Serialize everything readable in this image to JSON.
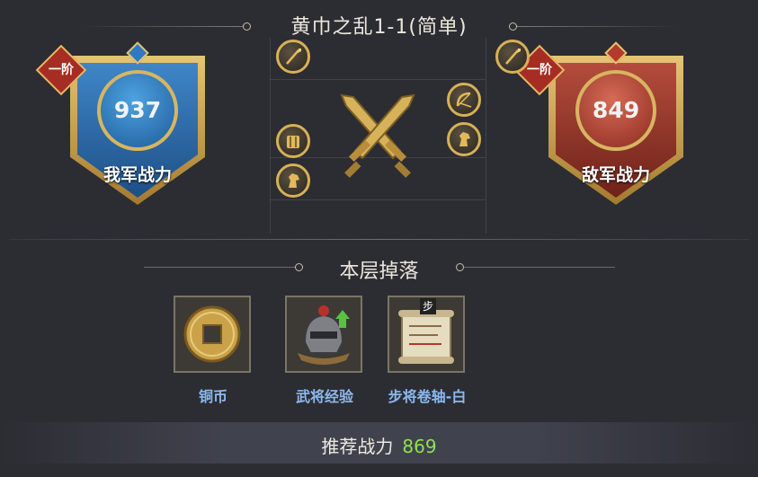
{
  "stage_title": "黄巾之乱1-1(简单)",
  "ally": {
    "rank": "一阶",
    "power": "937",
    "label": "我军战力"
  },
  "enemy": {
    "rank": "一阶",
    "power": "849",
    "label": "敌军战力"
  },
  "ally_units": [
    "spear-icon",
    "shield-icon",
    "horse-icon"
  ],
  "enemy_units": [
    "spear-icon",
    "bow-icon",
    "horse-icon"
  ],
  "drops": {
    "title": "本层掉落",
    "items": [
      {
        "name": "铜币",
        "icon": "coin-icon"
      },
      {
        "name": "武将经验",
        "icon": "helmet-icon"
      },
      {
        "name": "步将卷轴-白",
        "icon": "scroll-icon",
        "tag": "步"
      }
    ]
  },
  "recommended": {
    "label": "推荐战力",
    "value": "869"
  },
  "colors": {
    "ally": "#2f6fae",
    "enemy": "#9e3b2f",
    "gold": "#d7b157",
    "item_label": "#8cb9ee",
    "recommend_value": "#8fe24a"
  }
}
